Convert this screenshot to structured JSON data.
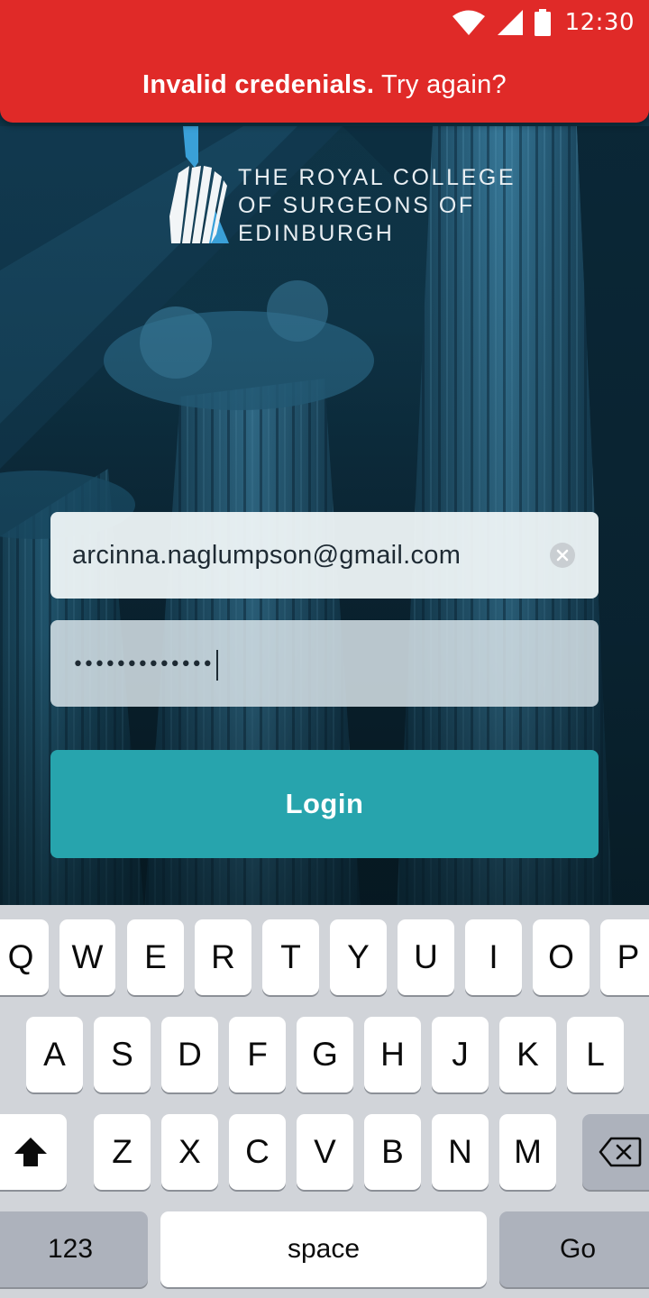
{
  "status_bar": {
    "time": "12:30",
    "icons": [
      "wifi-icon",
      "cellular-signal-icon",
      "battery-icon"
    ]
  },
  "error_banner": {
    "bold": "Invalid credenials.",
    "rest": " Try again?",
    "color": "#e02a28"
  },
  "logo": {
    "lines": [
      "THE ROYAL COLLEGE",
      "OF SURGEONS OF",
      "EDINBURGH"
    ]
  },
  "login_form": {
    "email_value": "arcinna.naglumpson@gmail.com",
    "password_masked": "•••••••••••••",
    "login_label": "Login",
    "accent_color": "#27a4ad"
  },
  "keyboard": {
    "row1": [
      "Q",
      "W",
      "E",
      "R",
      "T",
      "Y",
      "U",
      "I",
      "O",
      "P"
    ],
    "row2": [
      "A",
      "S",
      "D",
      "F",
      "G",
      "H",
      "J",
      "K",
      "L"
    ],
    "row3": [
      "Z",
      "X",
      "C",
      "V",
      "B",
      "N",
      "M"
    ],
    "numbers_label": "123",
    "space_label": "space",
    "go_label": "Go",
    "shift_icon": "shift-icon",
    "backspace_icon": "backspace-icon"
  }
}
